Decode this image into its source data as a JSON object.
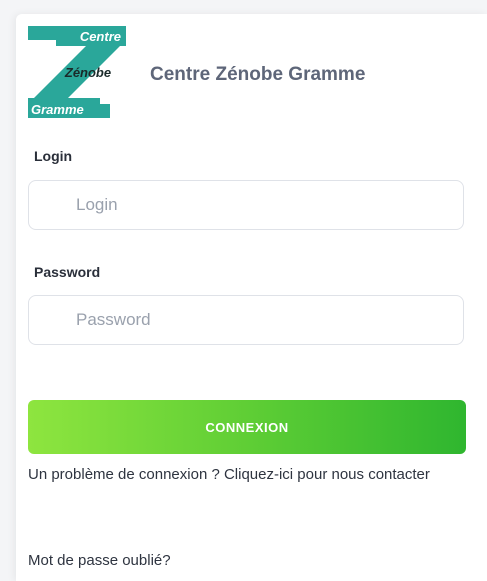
{
  "brand": {
    "logo_lines": [
      "Centre",
      "Zénobe",
      "Gramme"
    ],
    "title": "Centre Zénobe Gramme",
    "logo_color": "#2aa79a"
  },
  "form": {
    "login_label": "Login",
    "login_placeholder": "Login",
    "login_value": "",
    "password_label": "Password",
    "password_placeholder": "Password",
    "password_value": "",
    "submit_label": "CONNEXION"
  },
  "links": {
    "contact_problem": "Un problème de connexion ? Cliquez-ici pour nous contacter",
    "forgot_password": "Mot de passe oublié?"
  },
  "colors": {
    "button_gradient_start": "#8ee53f",
    "button_gradient_end": "#2fb62f",
    "title_text": "#5e6679"
  }
}
